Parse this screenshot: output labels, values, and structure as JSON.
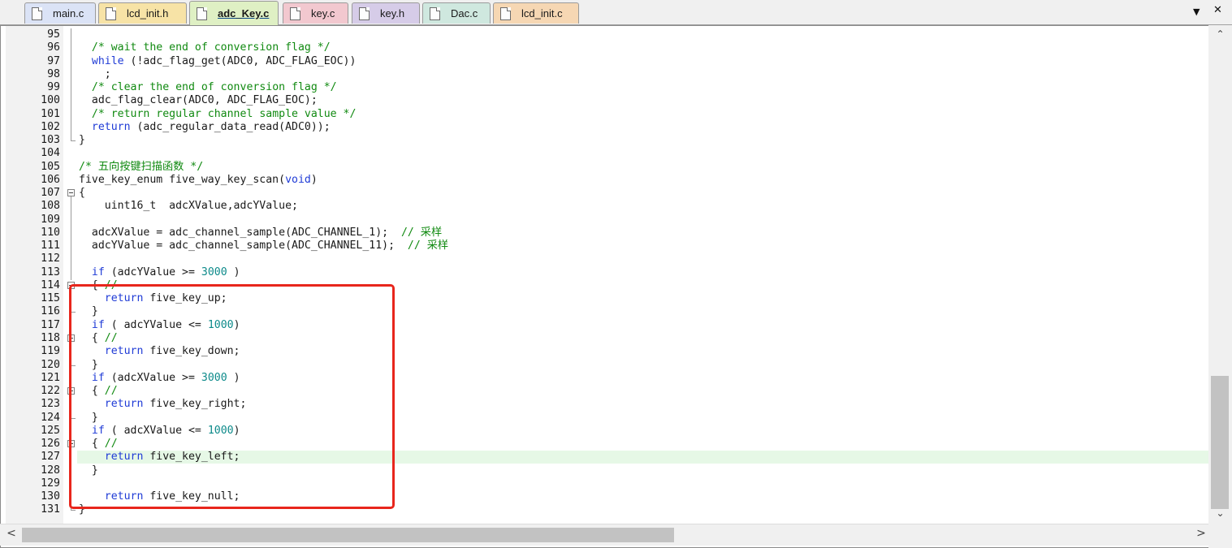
{
  "tabs": [
    {
      "label": "main.c",
      "color": "#dbe3f6"
    },
    {
      "label": "lcd_init.h",
      "color": "#f7e3a6"
    },
    {
      "label": "adc_Key.c",
      "color": "#dff0c4",
      "active": true
    },
    {
      "label": "key.c",
      "color": "#f2c8cf"
    },
    {
      "label": "key.h",
      "color": "#d6cce8"
    },
    {
      "label": "Dac.c",
      "color": "#cfe8df"
    },
    {
      "label": "lcd_init.c",
      "color": "#f6d7b3"
    }
  ],
  "tab_controls": {
    "dropdown": "▼",
    "close": "✕"
  },
  "editor": {
    "highlight_line": 127,
    "lines": [
      {
        "n": "95",
        "t": ""
      },
      {
        "n": "96",
        "t": "  /* wait the end of conversion flag */"
      },
      {
        "n": "97",
        "t": "  while (!adc_flag_get(ADC0, ADC_FLAG_EOC))"
      },
      {
        "n": "98",
        "t": "    ;"
      },
      {
        "n": "99",
        "t": "  /* clear the end of conversion flag */"
      },
      {
        "n": "100",
        "t": "  adc_flag_clear(ADC0, ADC_FLAG_EOC);"
      },
      {
        "n": "101",
        "t": "  /* return regular channel sample value */"
      },
      {
        "n": "102",
        "t": "  return (adc_regular_data_read(ADC0));"
      },
      {
        "n": "103",
        "t": "}"
      },
      {
        "n": "104",
        "t": ""
      },
      {
        "n": "105",
        "t": "/* 五向按键扫描函数 */"
      },
      {
        "n": "106",
        "t": "five_key_enum five_way_key_scan(void)"
      },
      {
        "n": "107",
        "t": "{"
      },
      {
        "n": "108",
        "t": "    uint16_t  adcXValue,adcYValue;"
      },
      {
        "n": "109",
        "t": ""
      },
      {
        "n": "110",
        "t": "  adcXValue = adc_channel_sample(ADC_CHANNEL_1);  // 采样"
      },
      {
        "n": "111",
        "t": "  adcYValue = adc_channel_sample(ADC_CHANNEL_11);  // 采样"
      },
      {
        "n": "112",
        "t": ""
      },
      {
        "n": "113",
        "t": "  if (adcYValue >= 3000 )"
      },
      {
        "n": "114",
        "t": "  { //"
      },
      {
        "n": "115",
        "t": "    return five_key_up;"
      },
      {
        "n": "116",
        "t": "  }"
      },
      {
        "n": "117",
        "t": "  if ( adcYValue <= 1000)"
      },
      {
        "n": "118",
        "t": "  { //"
      },
      {
        "n": "119",
        "t": "    return five_key_down;"
      },
      {
        "n": "120",
        "t": "  }"
      },
      {
        "n": "121",
        "t": "  if (adcXValue >= 3000 )"
      },
      {
        "n": "122",
        "t": "  { //"
      },
      {
        "n": "123",
        "t": "    return five_key_right;"
      },
      {
        "n": "124",
        "t": "  }"
      },
      {
        "n": "125",
        "t": "  if ( adcXValue <= 1000)"
      },
      {
        "n": "126",
        "t": "  { //"
      },
      {
        "n": "127",
        "t": "    return five_key_left;"
      },
      {
        "n": "128",
        "t": "  }"
      },
      {
        "n": "129",
        "t": ""
      },
      {
        "n": "130",
        "t": "    return five_key_null;"
      },
      {
        "n": "131",
        "t": "}"
      }
    ]
  },
  "scroll": {
    "up": "⌃",
    "down": "⌄",
    "left": "<",
    "right": ">"
  },
  "colors": {
    "comment": "#118a11",
    "keyword": "#1f3bd6",
    "number": "#0d8a8a",
    "annotation": "#e8261c",
    "current_line": "#e6f8e6"
  }
}
